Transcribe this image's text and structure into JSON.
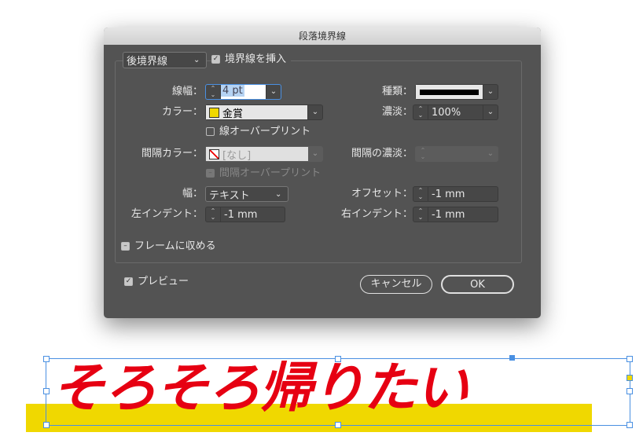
{
  "dialog": {
    "title": "段落境界線",
    "border_type": "後境界線",
    "insert_rule": "境界線を挿入",
    "weight_label": "線幅：",
    "weight_value": "4 pt",
    "type_label": "種類：",
    "color_label": "カラー：",
    "color_value": "金賞",
    "color_swatch": "#f0d800",
    "tint_label": "濃淡：",
    "tint_value": "100%",
    "overprint_stroke": "線オーバープリント",
    "gap_color_label": "間隔カラー：",
    "gap_color_value": "[なし]",
    "gap_tint_label": "間隔の濃淡：",
    "overprint_gap": "間隔オーバープリント",
    "width_label": "幅：",
    "width_value": "テキスト",
    "offset_label": "オフセット：",
    "offset_value": "-1 mm",
    "left_indent_label": "左インデント：",
    "left_indent_value": "-1 mm",
    "right_indent_label": "右インデント：",
    "right_indent_value": "-1 mm",
    "keep_in_frame": "フレームに収める",
    "preview": "プレビュー",
    "cancel": "キャンセル",
    "ok": "OK"
  },
  "canvas": {
    "text": "そろそろ帰りたい",
    "text_color": "#e60012",
    "rule_color": "#f0d800"
  }
}
